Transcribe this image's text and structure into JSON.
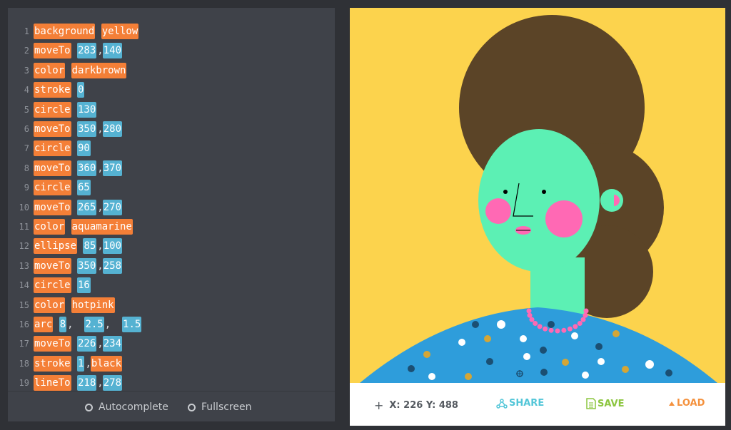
{
  "editor": {
    "lines": [
      {
        "num": "1",
        "tokens": [
          {
            "t": "background",
            "k": "kw"
          },
          {
            "t": " "
          },
          {
            "t": "yellow",
            "k": "kw"
          }
        ]
      },
      {
        "num": "2",
        "tokens": [
          {
            "t": "moveTo",
            "k": "kw"
          },
          {
            "t": " "
          },
          {
            "t": "283",
            "k": "num"
          },
          {
            "t": ","
          },
          {
            "t": "140",
            "k": "num"
          }
        ]
      },
      {
        "num": "3",
        "tokens": [
          {
            "t": "color",
            "k": "kw"
          },
          {
            "t": " "
          },
          {
            "t": "darkbrown",
            "k": "kw"
          }
        ]
      },
      {
        "num": "4",
        "tokens": [
          {
            "t": "stroke",
            "k": "kw"
          },
          {
            "t": " "
          },
          {
            "t": "0",
            "k": "num"
          }
        ]
      },
      {
        "num": "5",
        "tokens": [
          {
            "t": "circle",
            "k": "kw"
          },
          {
            "t": " "
          },
          {
            "t": "130",
            "k": "num"
          }
        ]
      },
      {
        "num": "6",
        "tokens": [
          {
            "t": "moveTo",
            "k": "kw"
          },
          {
            "t": " "
          },
          {
            "t": "350",
            "k": "num"
          },
          {
            "t": ","
          },
          {
            "t": "280",
            "k": "num"
          }
        ]
      },
      {
        "num": "7",
        "tokens": [
          {
            "t": "circle",
            "k": "kw"
          },
          {
            "t": " "
          },
          {
            "t": "90",
            "k": "num"
          }
        ]
      },
      {
        "num": "8",
        "tokens": [
          {
            "t": "moveTo",
            "k": "kw"
          },
          {
            "t": " "
          },
          {
            "t": "360",
            "k": "num"
          },
          {
            "t": ","
          },
          {
            "t": "370",
            "k": "num"
          }
        ]
      },
      {
        "num": "9",
        "tokens": [
          {
            "t": "circle",
            "k": "kw"
          },
          {
            "t": " "
          },
          {
            "t": "65",
            "k": "num"
          }
        ]
      },
      {
        "num": "10",
        "tokens": [
          {
            "t": "moveTo",
            "k": "kw"
          },
          {
            "t": " "
          },
          {
            "t": "265",
            "k": "num"
          },
          {
            "t": ","
          },
          {
            "t": "270",
            "k": "num"
          }
        ]
      },
      {
        "num": "11",
        "tokens": [
          {
            "t": "color",
            "k": "kw"
          },
          {
            "t": " "
          },
          {
            "t": "aquamarine",
            "k": "kw"
          }
        ]
      },
      {
        "num": "12",
        "tokens": [
          {
            "t": "ellipse",
            "k": "kw"
          },
          {
            "t": " "
          },
          {
            "t": "85",
            "k": "num"
          },
          {
            "t": ","
          },
          {
            "t": "100",
            "k": "num"
          }
        ]
      },
      {
        "num": "13",
        "tokens": [
          {
            "t": "moveTo",
            "k": "kw"
          },
          {
            "t": " "
          },
          {
            "t": "350",
            "k": "num"
          },
          {
            "t": ","
          },
          {
            "t": "258",
            "k": "num"
          }
        ]
      },
      {
        "num": "14",
        "tokens": [
          {
            "t": "circle",
            "k": "kw"
          },
          {
            "t": " "
          },
          {
            "t": "16",
            "k": "num"
          }
        ]
      },
      {
        "num": "15",
        "tokens": [
          {
            "t": "color",
            "k": "kw"
          },
          {
            "t": " "
          },
          {
            "t": "hotpink",
            "k": "kw"
          }
        ]
      },
      {
        "num": "16",
        "tokens": [
          {
            "t": "arc",
            "k": "kw"
          },
          {
            "t": " "
          },
          {
            "t": "8",
            "k": "num"
          },
          {
            "t": ",  "
          },
          {
            "t": "2.5",
            "k": "num"
          },
          {
            "t": ",  "
          },
          {
            "t": "1.5",
            "k": "num"
          }
        ]
      },
      {
        "num": "17",
        "tokens": [
          {
            "t": "moveTo",
            "k": "kw"
          },
          {
            "t": " "
          },
          {
            "t": "226",
            "k": "num"
          },
          {
            "t": ","
          },
          {
            "t": "234",
            "k": "num"
          }
        ]
      },
      {
        "num": "18",
        "tokens": [
          {
            "t": "stroke",
            "k": "kw"
          },
          {
            "t": " "
          },
          {
            "t": "1",
            "k": "num"
          },
          {
            "t": ","
          },
          {
            "t": "black",
            "k": "kw"
          }
        ]
      },
      {
        "num": "19",
        "tokens": [
          {
            "t": "lineTo",
            "k": "kw"
          },
          {
            "t": " "
          },
          {
            "t": "218",
            "k": "num"
          },
          {
            "t": ","
          },
          {
            "t": "278",
            "k": "num"
          }
        ]
      }
    ],
    "options": {
      "autocomplete_label": "Autocomplete",
      "fullscreen_label": "Fullscreen"
    }
  },
  "preview": {
    "coord_label": "X: 226 Y: 488",
    "share_label": "SHARE",
    "save_label": "SAVE",
    "load_label": "LOAD"
  },
  "colors": {
    "keyword_bg": "#f47f37",
    "number_bg": "#55b2d2",
    "canvas_bg": "#fcd34d",
    "hair": "#5b4427",
    "skin": "#5cf0b4",
    "cheeks": "#ff69b4",
    "dress": "#2e9ddb",
    "share": "#53c6d8",
    "save": "#8cc63f",
    "load": "#f4913d"
  }
}
